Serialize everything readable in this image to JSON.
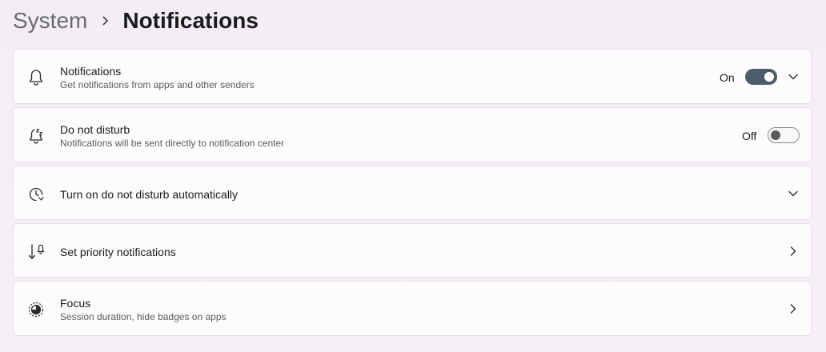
{
  "breadcrumb": {
    "parent": "System",
    "current": "Notifications"
  },
  "cards": [
    {
      "title": "Notifications",
      "subtitle": "Get notifications from apps and other senders",
      "state": "On",
      "icon": "bell-icon"
    },
    {
      "title": "Do not disturb",
      "subtitle": "Notifications will be sent directly to notification center",
      "state": "Off",
      "icon": "bell-snooze-icon"
    },
    {
      "title": "Turn on do not disturb automatically",
      "icon": "clock-refresh-icon"
    },
    {
      "title": "Set priority notifications",
      "icon": "priority-arrow-icon"
    },
    {
      "title": "Focus",
      "subtitle": "Session duration, hide badges on apps",
      "icon": "focus-icon"
    }
  ],
  "colors": {
    "accent": "#4c5c6b",
    "background": "#f4eef5",
    "card": "#fdfbfd"
  }
}
